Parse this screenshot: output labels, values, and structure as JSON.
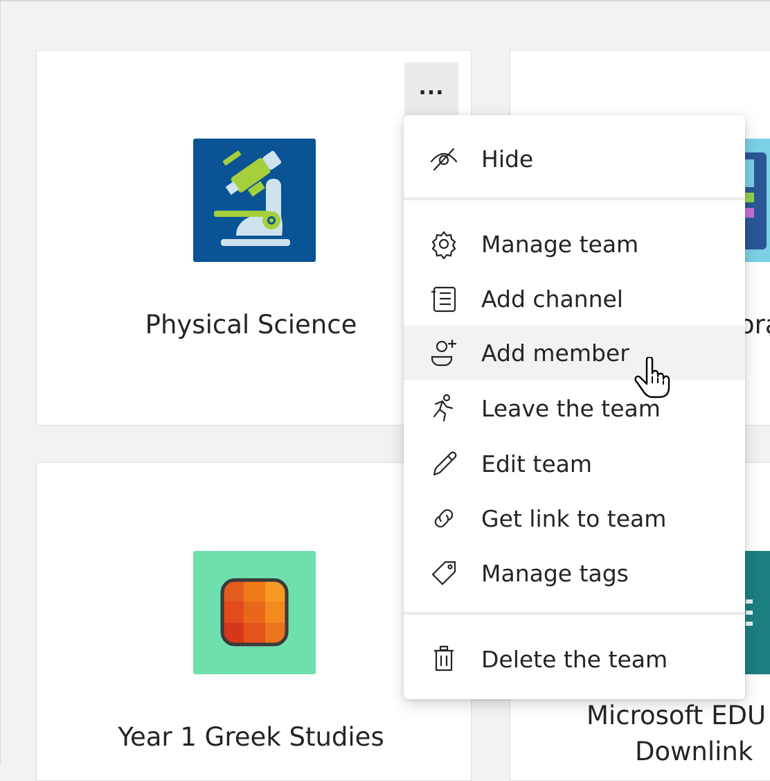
{
  "cards": {
    "physical_science": {
      "name": "Physical Science"
    },
    "year1_greek": {
      "name": "Year 1 Greek Studies"
    },
    "partial_top_right": {
      "name_fragment": "ora"
    },
    "partial_bottom_right": {
      "name_line1": "Microsoft EDU",
      "name_line2": "Downlink"
    }
  },
  "more_button": {
    "label": "..."
  },
  "menu": {
    "items": [
      {
        "label": "Hide",
        "icon": "hide-eye-icon"
      },
      {
        "label": "Manage team",
        "icon": "gear-icon"
      },
      {
        "label": "Add channel",
        "icon": "channel-list-icon"
      },
      {
        "label": "Add member",
        "icon": "add-person-icon",
        "hovered": true
      },
      {
        "label": "Leave the team",
        "icon": "running-person-icon"
      },
      {
        "label": "Edit team",
        "icon": "pencil-icon"
      },
      {
        "label": "Get link to team",
        "icon": "link-icon"
      },
      {
        "label": "Manage tags",
        "icon": "tag-icon"
      },
      {
        "label": "Delete the team",
        "icon": "trash-icon"
      }
    ]
  },
  "colors": {
    "page_bg": "#f3f2f1",
    "physical_science_tile": "#0a5394",
    "greek_tile": "#6fdfad",
    "teal_tile": "#1c7f80",
    "cyan_tile": "#7bd0e6",
    "hover_bg": "#f3f2f1"
  }
}
